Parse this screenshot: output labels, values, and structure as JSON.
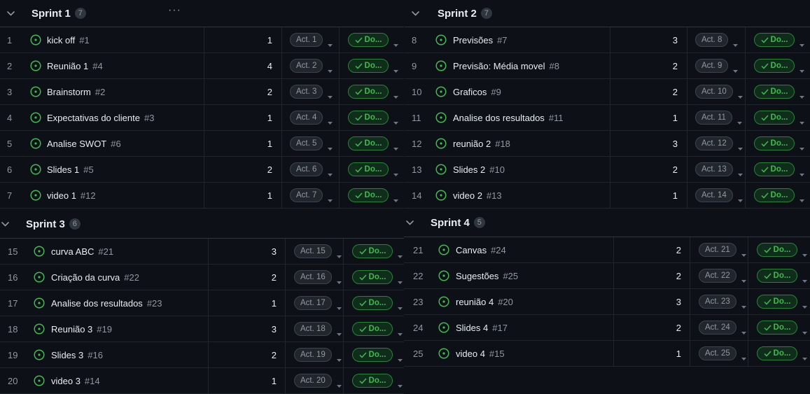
{
  "colors": {
    "background": "#0d1117",
    "done_green": "#3fb950",
    "open_icon": "#3fb950"
  },
  "groups": [
    {
      "title": "Sprint 1",
      "count": "7",
      "menu": "···",
      "rows": [
        {
          "num": "1",
          "title": "kick off",
          "issue": "#1",
          "estimate": "1",
          "iteration": "Act. 1",
          "status": "Do..."
        },
        {
          "num": "2",
          "title": "Reunião 1",
          "issue": "#4",
          "estimate": "4",
          "iteration": "Act. 2",
          "status": "Do..."
        },
        {
          "num": "3",
          "title": "Brainstorm",
          "issue": "#2",
          "estimate": "2",
          "iteration": "Act. 3",
          "status": "Do..."
        },
        {
          "num": "4",
          "title": "Expectativas do cliente",
          "issue": "#3",
          "estimate": "1",
          "iteration": "Act. 4",
          "status": "Do..."
        },
        {
          "num": "5",
          "title": "Analise SWOT",
          "issue": "#6",
          "estimate": "1",
          "iteration": "Act. 5",
          "status": "Do..."
        },
        {
          "num": "6",
          "title": "Slides 1",
          "issue": "#5",
          "estimate": "2",
          "iteration": "Act. 6",
          "status": "Do..."
        },
        {
          "num": "7",
          "title": "video 1",
          "issue": "#12",
          "estimate": "1",
          "iteration": "Act. 7",
          "status": "Do..."
        }
      ]
    },
    {
      "title": "Sprint 2",
      "count": "7",
      "rows": [
        {
          "num": "8",
          "title": "Previsões",
          "issue": "#7",
          "estimate": "3",
          "iteration": "Act. 8",
          "status": "Do..."
        },
        {
          "num": "9",
          "title": "Previsão: Média movel",
          "issue": "#8",
          "estimate": "2",
          "iteration": "Act. 9",
          "status": "Do..."
        },
        {
          "num": "10",
          "title": "Graficos",
          "issue": "#9",
          "estimate": "2",
          "iteration": "Act. 10",
          "status": "Do..."
        },
        {
          "num": "11",
          "title": "Analise dos resultados",
          "issue": "#11",
          "estimate": "1",
          "iteration": "Act. 11",
          "status": "Do..."
        },
        {
          "num": "12",
          "title": "reunião 2",
          "issue": "#18",
          "estimate": "3",
          "iteration": "Act. 12",
          "status": "Do..."
        },
        {
          "num": "13",
          "title": "Slides 2",
          "issue": "#10",
          "estimate": "2",
          "iteration": "Act. 13",
          "status": "Do..."
        },
        {
          "num": "14",
          "title": "video 2",
          "issue": "#13",
          "estimate": "1",
          "iteration": "Act. 14",
          "status": "Do..."
        }
      ]
    },
    {
      "title": "Sprint 3",
      "count": "6",
      "rows": [
        {
          "num": "15",
          "title": "curva ABC",
          "issue": "#21",
          "estimate": "3",
          "iteration": "Act. 15",
          "status": "Do..."
        },
        {
          "num": "16",
          "title": "Criação da curva",
          "issue": "#22",
          "estimate": "2",
          "iteration": "Act. 16",
          "status": "Do..."
        },
        {
          "num": "17",
          "title": "Analise dos resultados",
          "issue": "#23",
          "estimate": "1",
          "iteration": "Act. 17",
          "status": "Do..."
        },
        {
          "num": "18",
          "title": "Reunião 3",
          "issue": "#19",
          "estimate": "3",
          "iteration": "Act. 18",
          "status": "Do..."
        },
        {
          "num": "19",
          "title": "Slides 3",
          "issue": "#16",
          "estimate": "2",
          "iteration": "Act. 19",
          "status": "Do..."
        },
        {
          "num": "20",
          "title": "video 3",
          "issue": "#14",
          "estimate": "1",
          "iteration": "Act. 20",
          "status": "Do..."
        }
      ]
    },
    {
      "title": "Sprint 4",
      "count": "5",
      "rows": [
        {
          "num": "21",
          "title": "Canvas",
          "issue": "#24",
          "estimate": "2",
          "iteration": "Act. 21",
          "status": "Do..."
        },
        {
          "num": "22",
          "title": "Sugestões",
          "issue": "#25",
          "estimate": "2",
          "iteration": "Act. 22",
          "status": "Do..."
        },
        {
          "num": "23",
          "title": "reunião 4",
          "issue": "#20",
          "estimate": "3",
          "iteration": "Act. 23",
          "status": "Do..."
        },
        {
          "num": "24",
          "title": "Slides 4",
          "issue": "#17",
          "estimate": "2",
          "iteration": "Act. 24",
          "status": "Do..."
        },
        {
          "num": "25",
          "title": "video 4",
          "issue": "#15",
          "estimate": "1",
          "iteration": "Act. 25",
          "status": "Do..."
        }
      ]
    }
  ]
}
